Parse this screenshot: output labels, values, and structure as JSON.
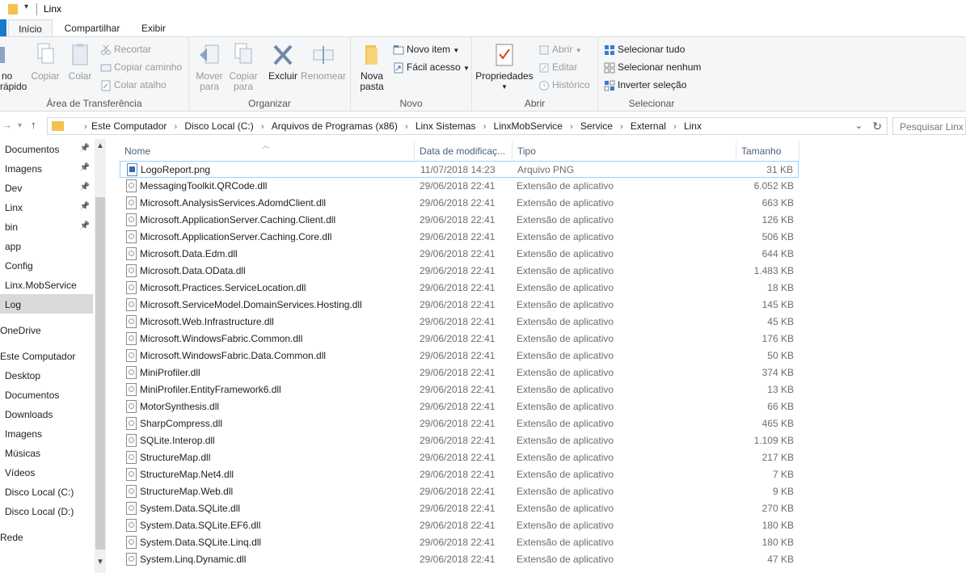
{
  "window": {
    "title": "Linx"
  },
  "ribbon_tabs": {
    "home": "Início",
    "share": "Compartilhar",
    "view": "Exibir"
  },
  "ribbon": {
    "clipboard": {
      "label": "Área de Transferência",
      "pin_quick_line1": "no",
      "pin_quick_line2": "rápido",
      "copy": "Copiar",
      "paste": "Colar",
      "cut": "Recortar",
      "copy_path": "Copiar caminho",
      "paste_shortcut": "Colar atalho"
    },
    "organize": {
      "label": "Organizar",
      "move_to_line1": "Mover",
      "move_to_line2": "para",
      "copy_to_line1": "Copiar",
      "copy_to_line2": "para",
      "delete": "Excluir",
      "rename": "Renomear"
    },
    "new": {
      "label": "Novo",
      "new_folder_line1": "Nova",
      "new_folder_line2": "pasta",
      "new_item": "Novo item",
      "easy_access": "Fácil acesso"
    },
    "open": {
      "label": "Abrir",
      "properties": "Propriedades",
      "open": "Abrir",
      "edit": "Editar",
      "history": "Histórico"
    },
    "select": {
      "label": "Selecionar",
      "select_all": "Selecionar tudo",
      "select_none": "Selecionar nenhum",
      "invert": "Inverter seleção"
    }
  },
  "address": {
    "crumbs": [
      "Este Computador",
      "Disco Local (C:)",
      "Arquivos de Programas (x86)",
      "Linx Sistemas",
      "LinxMobService",
      "Service",
      "External",
      "Linx"
    ],
    "search_placeholder": "Pesquisar Linx"
  },
  "nav_pane": {
    "items": [
      {
        "label": "Documentos",
        "pinned": true
      },
      {
        "label": "Imagens",
        "pinned": true
      },
      {
        "label": "Dev",
        "pinned": true
      },
      {
        "label": "Linx",
        "pinned": true
      },
      {
        "label": "bin",
        "pinned": true
      },
      {
        "label": "app",
        "pinned": false
      },
      {
        "label": "Config",
        "pinned": false
      },
      {
        "label": "Linx.MobService",
        "pinned": false
      },
      {
        "label": "Log",
        "pinned": false
      },
      {
        "label": "OneDrive",
        "pinned": false
      },
      {
        "label": "Este Computador",
        "pinned": false
      },
      {
        "label": "Desktop",
        "pinned": false
      },
      {
        "label": "Documentos",
        "pinned": false
      },
      {
        "label": "Downloads",
        "pinned": false
      },
      {
        "label": "Imagens",
        "pinned": false
      },
      {
        "label": "Músicas",
        "pinned": false
      },
      {
        "label": "Vídeos",
        "pinned": false
      },
      {
        "label": "Disco Local (C:)",
        "pinned": false
      },
      {
        "label": "Disco Local (D:)",
        "pinned": false
      },
      {
        "label": "Rede",
        "pinned": false
      }
    ]
  },
  "columns": {
    "name": "Nome",
    "date": "Data de modificaç...",
    "type": "Tipo",
    "size": "Tamanho"
  },
  "files": [
    {
      "name": "LogoReport.png",
      "date": "11/07/2018 14:23",
      "type": "Arquivo PNG",
      "size": "31 KB"
    },
    {
      "name": "MessagingToolkit.QRCode.dll",
      "date": "29/06/2018 22:41",
      "type": "Extensão de aplicativo",
      "size": "6.052 KB"
    },
    {
      "name": "Microsoft.AnalysisServices.AdomdClient.dll",
      "date": "29/06/2018 22:41",
      "type": "Extensão de aplicativo",
      "size": "663 KB"
    },
    {
      "name": "Microsoft.ApplicationServer.Caching.Client.dll",
      "date": "29/06/2018 22:41",
      "type": "Extensão de aplicativo",
      "size": "126 KB"
    },
    {
      "name": "Microsoft.ApplicationServer.Caching.Core.dll",
      "date": "29/06/2018 22:41",
      "type": "Extensão de aplicativo",
      "size": "506 KB"
    },
    {
      "name": "Microsoft.Data.Edm.dll",
      "date": "29/06/2018 22:41",
      "type": "Extensão de aplicativo",
      "size": "644 KB"
    },
    {
      "name": "Microsoft.Data.OData.dll",
      "date": "29/06/2018 22:41",
      "type": "Extensão de aplicativo",
      "size": "1.483 KB"
    },
    {
      "name": "Microsoft.Practices.ServiceLocation.dll",
      "date": "29/06/2018 22:41",
      "type": "Extensão de aplicativo",
      "size": "18 KB"
    },
    {
      "name": "Microsoft.ServiceModel.DomainServices.Hosting.dll",
      "date": "29/06/2018 22:41",
      "type": "Extensão de aplicativo",
      "size": "145 KB"
    },
    {
      "name": "Microsoft.Web.Infrastructure.dll",
      "date": "29/06/2018 22:41",
      "type": "Extensão de aplicativo",
      "size": "45 KB"
    },
    {
      "name": "Microsoft.WindowsFabric.Common.dll",
      "date": "29/06/2018 22:41",
      "type": "Extensão de aplicativo",
      "size": "176 KB"
    },
    {
      "name": "Microsoft.WindowsFabric.Data.Common.dll",
      "date": "29/06/2018 22:41",
      "type": "Extensão de aplicativo",
      "size": "50 KB"
    },
    {
      "name": "MiniProfiler.dll",
      "date": "29/06/2018 22:41",
      "type": "Extensão de aplicativo",
      "size": "374 KB"
    },
    {
      "name": "MiniProfiler.EntityFramework6.dll",
      "date": "29/06/2018 22:41",
      "type": "Extensão de aplicativo",
      "size": "13 KB"
    },
    {
      "name": "MotorSynthesis.dll",
      "date": "29/06/2018 22:41",
      "type": "Extensão de aplicativo",
      "size": "66 KB"
    },
    {
      "name": "SharpCompress.dll",
      "date": "29/06/2018 22:41",
      "type": "Extensão de aplicativo",
      "size": "465 KB"
    },
    {
      "name": "SQLite.Interop.dll",
      "date": "29/06/2018 22:41",
      "type": "Extensão de aplicativo",
      "size": "1.109 KB"
    },
    {
      "name": "StructureMap.dll",
      "date": "29/06/2018 22:41",
      "type": "Extensão de aplicativo",
      "size": "217 KB"
    },
    {
      "name": "StructureMap.Net4.dll",
      "date": "29/06/2018 22:41",
      "type": "Extensão de aplicativo",
      "size": "7 KB"
    },
    {
      "name": "StructureMap.Web.dll",
      "date": "29/06/2018 22:41",
      "type": "Extensão de aplicativo",
      "size": "9 KB"
    },
    {
      "name": "System.Data.SQLite.dll",
      "date": "29/06/2018 22:41",
      "type": "Extensão de aplicativo",
      "size": "270 KB"
    },
    {
      "name": "System.Data.SQLite.EF6.dll",
      "date": "29/06/2018 22:41",
      "type": "Extensão de aplicativo",
      "size": "180 KB"
    },
    {
      "name": "System.Data.SQLite.Linq.dll",
      "date": "29/06/2018 22:41",
      "type": "Extensão de aplicativo",
      "size": "180 KB"
    },
    {
      "name": "System.Linq.Dynamic.dll",
      "date": "29/06/2018 22:41",
      "type": "Extensão de aplicativo",
      "size": "47 KB"
    }
  ],
  "colors": {
    "accent": "#1979ca",
    "folder": "#f2c14e",
    "selection_border": "#99d1ff"
  }
}
